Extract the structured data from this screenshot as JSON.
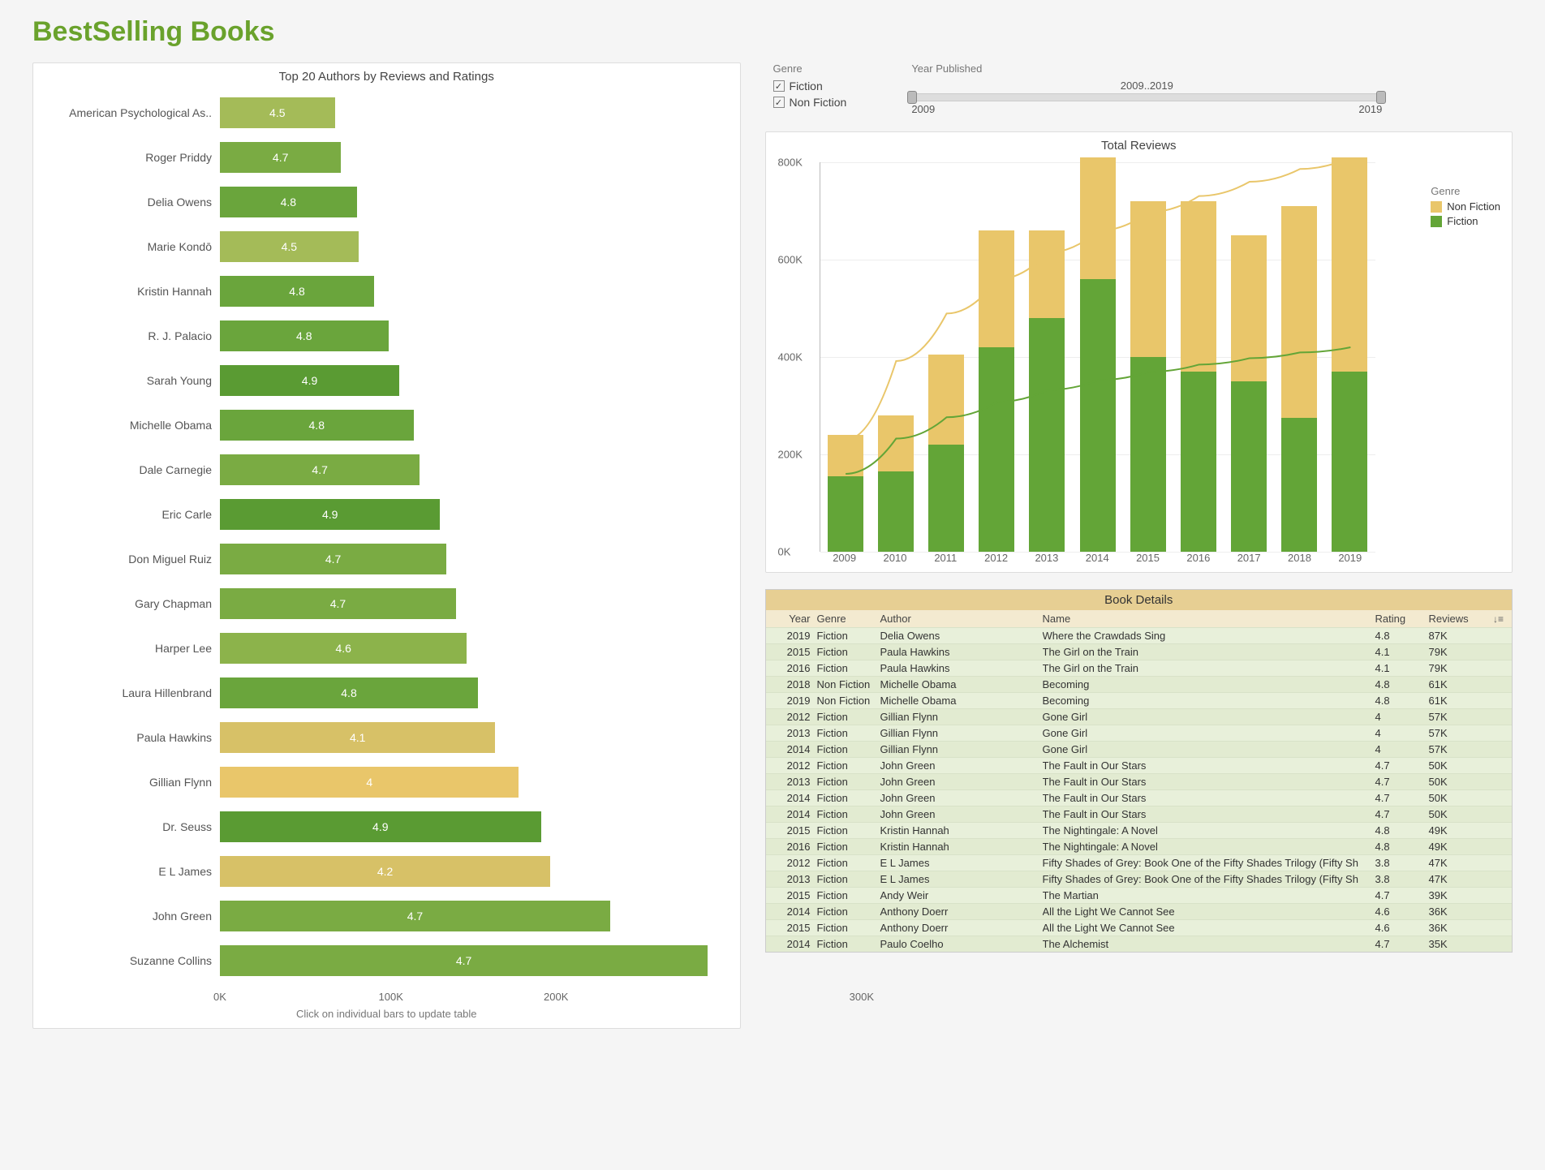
{
  "page_title": "BestSelling Books",
  "left_chart": {
    "title": "Top 20 Authors by Reviews and Ratings",
    "subtitle": "Click on individual bars to update table",
    "xticks": [
      "0K",
      "100K",
      "200K",
      "300K"
    ]
  },
  "filters": {
    "genre_label": "Genre",
    "fiction_label": "Fiction",
    "nonfiction_label": "Non Fiction",
    "year_label": "Year Published",
    "year_range_text": "2009..2019",
    "year_min": "2009",
    "year_max": "2019"
  },
  "reviews_chart_title": "Total Reviews",
  "legend": {
    "title": "Genre",
    "nonfiction": "Non Fiction",
    "fiction": "Fiction"
  },
  "table": {
    "title": "Book Details",
    "hdr_year": "Year",
    "hdr_genre": "Genre",
    "hdr_author": "Author",
    "hdr_name": "Name",
    "hdr_rating": "Rating",
    "hdr_reviews": "Reviews",
    "sort_icon": "↓≡"
  },
  "chart_data": {
    "authors_bar": {
      "type": "bar",
      "title": "Top 20 Authors by Reviews and Ratings",
      "xlabel": "",
      "ylabel": "",
      "x_ticks_k": [
        0,
        100,
        200,
        300
      ],
      "color_scale_note": "bar color encodes rating (yellow ~4.0 → dark green ~4.9)",
      "rows": [
        {
          "author": "American Psychological As..",
          "rating": 4.5,
          "reviews_k": 73
        },
        {
          "author": "Roger Priddy",
          "rating": 4.7,
          "reviews_k": 77
        },
        {
          "author": "Delia Owens",
          "rating": 4.8,
          "reviews_k": 87
        },
        {
          "author": "Marie Kondō",
          "rating": 4.5,
          "reviews_k": 88
        },
        {
          "author": "Kristin Hannah",
          "rating": 4.8,
          "reviews_k": 98
        },
        {
          "author": "R. J. Palacio",
          "rating": 4.8,
          "reviews_k": 107
        },
        {
          "author": "Sarah Young",
          "rating": 4.9,
          "reviews_k": 114
        },
        {
          "author": "Michelle Obama",
          "rating": 4.8,
          "reviews_k": 123
        },
        {
          "author": "Dale Carnegie",
          "rating": 4.7,
          "reviews_k": 127
        },
        {
          "author": "Eric Carle",
          "rating": 4.9,
          "reviews_k": 140
        },
        {
          "author": "Don Miguel Ruiz",
          "rating": 4.7,
          "reviews_k": 144
        },
        {
          "author": "Gary Chapman",
          "rating": 4.7,
          "reviews_k": 150
        },
        {
          "author": "Harper Lee",
          "rating": 4.6,
          "reviews_k": 157
        },
        {
          "author": "Laura Hillenbrand",
          "rating": 4.8,
          "reviews_k": 164
        },
        {
          "author": "Paula Hawkins",
          "rating": 4.1,
          "reviews_k": 175
        },
        {
          "author": "Gillian Flynn",
          "rating": 4.0,
          "reviews_k": 190
        },
        {
          "author": "Dr. Seuss",
          "rating": 4.9,
          "reviews_k": 204
        },
        {
          "author": "E L James",
          "rating": 4.2,
          "reviews_k": 210
        },
        {
          "author": "John Green",
          "rating": 4.7,
          "reviews_k": 248
        },
        {
          "author": "Suzanne Collins",
          "rating": 4.7,
          "reviews_k": 310
        }
      ]
    },
    "reviews_stacked": {
      "type": "bar",
      "stacked": true,
      "title": "Total Reviews",
      "ylabel": "",
      "ylim": [
        0,
        800
      ],
      "y_ticks_k": [
        0,
        200,
        400,
        600,
        800
      ],
      "categories": [
        "2009",
        "2010",
        "2011",
        "2012",
        "2013",
        "2014",
        "2015",
        "2016",
        "2017",
        "2018",
        "2019"
      ],
      "series": [
        {
          "name": "Fiction",
          "color": "#63a537",
          "values_k": [
            155,
            165,
            220,
            420,
            480,
            560,
            400,
            370,
            350,
            275,
            370
          ]
        },
        {
          "name": "Non Fiction",
          "color": "#e9c66a",
          "values_k": [
            85,
            115,
            185,
            240,
            180,
            250,
            320,
            350,
            300,
            435,
            440
          ]
        }
      ],
      "trend_lines": [
        {
          "name": "Non Fiction trend",
          "color": "#e9c66a"
        },
        {
          "name": "Fiction trend",
          "color": "#63a537"
        }
      ]
    },
    "book_table": {
      "type": "table",
      "columns": [
        "Year",
        "Genre",
        "Author",
        "Name",
        "Rating",
        "Reviews"
      ],
      "rows": [
        [
          "2019",
          "Fiction",
          "Delia Owens",
          "Where the Crawdads Sing",
          "4.8",
          "87K"
        ],
        [
          "2015",
          "Fiction",
          "Paula Hawkins",
          "The Girl on the Train",
          "4.1",
          "79K"
        ],
        [
          "2016",
          "Fiction",
          "Paula Hawkins",
          "The Girl on the Train",
          "4.1",
          "79K"
        ],
        [
          "2018",
          "Non Fiction",
          "Michelle Obama",
          "Becoming",
          "4.8",
          "61K"
        ],
        [
          "2019",
          "Non Fiction",
          "Michelle Obama",
          "Becoming",
          "4.8",
          "61K"
        ],
        [
          "2012",
          "Fiction",
          "Gillian Flynn",
          "Gone Girl",
          "4",
          "57K"
        ],
        [
          "2013",
          "Fiction",
          "Gillian Flynn",
          "Gone Girl",
          "4",
          "57K"
        ],
        [
          "2014",
          "Fiction",
          "Gillian Flynn",
          "Gone Girl",
          "4",
          "57K"
        ],
        [
          "2012",
          "Fiction",
          "John Green",
          "The Fault in Our Stars",
          "4.7",
          "50K"
        ],
        [
          "2013",
          "Fiction",
          "John Green",
          "The Fault in Our Stars",
          "4.7",
          "50K"
        ],
        [
          "2014",
          "Fiction",
          "John Green",
          "The Fault in Our Stars",
          "4.7",
          "50K"
        ],
        [
          "2014",
          "Fiction",
          "John Green",
          "The Fault in Our Stars",
          "4.7",
          "50K"
        ],
        [
          "2015",
          "Fiction",
          "Kristin Hannah",
          "The Nightingale: A Novel",
          "4.8",
          "49K"
        ],
        [
          "2016",
          "Fiction",
          "Kristin Hannah",
          "The Nightingale: A Novel",
          "4.8",
          "49K"
        ],
        [
          "2012",
          "Fiction",
          "E L James",
          "Fifty Shades of Grey: Book One of the Fifty Shades Trilogy (Fifty Sh",
          "3.8",
          "47K"
        ],
        [
          "2013",
          "Fiction",
          "E L James",
          "Fifty Shades of Grey: Book One of the Fifty Shades Trilogy (Fifty Sh",
          "3.8",
          "47K"
        ],
        [
          "2015",
          "Fiction",
          "Andy Weir",
          "The Martian",
          "4.7",
          "39K"
        ],
        [
          "2014",
          "Fiction",
          "Anthony Doerr",
          "All the Light We Cannot See",
          "4.6",
          "36K"
        ],
        [
          "2015",
          "Fiction",
          "Anthony Doerr",
          "All the Light We Cannot See",
          "4.6",
          "36K"
        ],
        [
          "2014",
          "Fiction",
          "Paulo Coelho",
          "The Alchemist",
          "4.7",
          "35K"
        ]
      ]
    }
  }
}
